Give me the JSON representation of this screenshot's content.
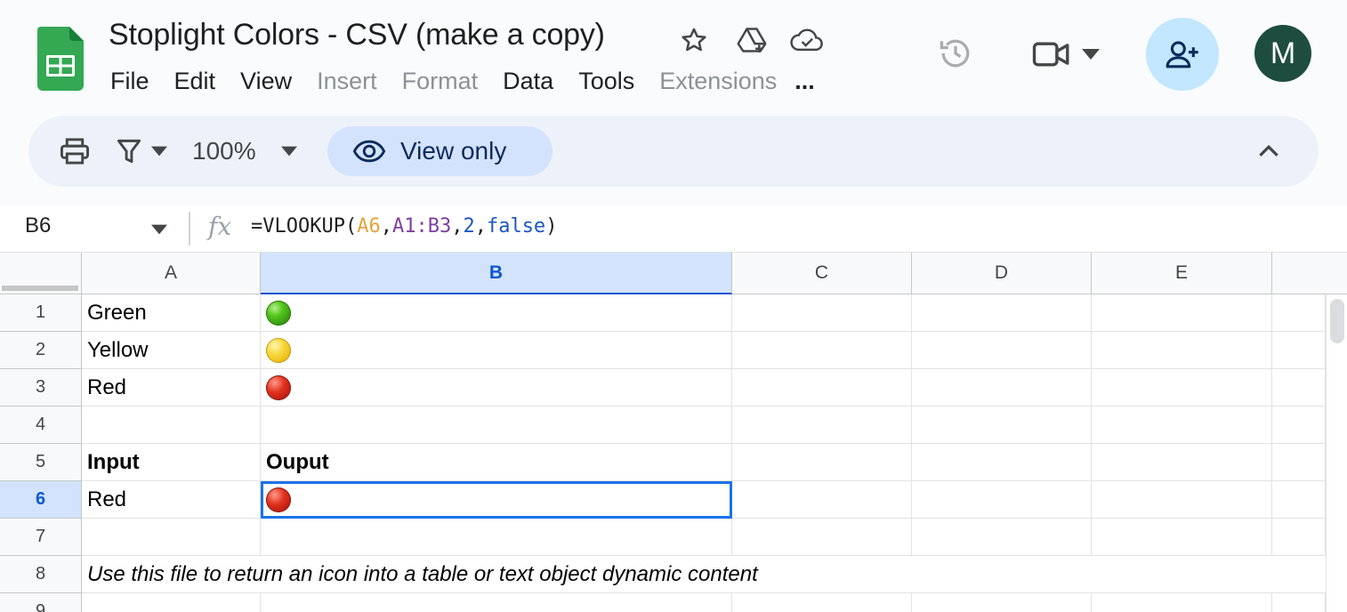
{
  "doc": {
    "title": "Stoplight Colors - CSV (make a copy)",
    "menu": [
      {
        "label": "File",
        "disabled": false
      },
      {
        "label": "Edit",
        "disabled": false
      },
      {
        "label": "View",
        "disabled": false
      },
      {
        "label": "Insert",
        "disabled": true
      },
      {
        "label": "Format",
        "disabled": true
      },
      {
        "label": "Data",
        "disabled": false
      },
      {
        "label": "Tools",
        "disabled": false
      },
      {
        "label": "Extensions",
        "disabled": true
      }
    ],
    "menu_more": "...",
    "avatar_letter": "M"
  },
  "toolbar": {
    "zoom": "100%",
    "view_only": "View only"
  },
  "formula_bar": {
    "name_box": "B6",
    "fx": "fx",
    "formula_parts": [
      {
        "text": "=VLOOKUP(",
        "color": "default"
      },
      {
        "text": "A6",
        "color": "orange"
      },
      {
        "text": ",",
        "color": "default"
      },
      {
        "text": "A1:B3",
        "color": "purple"
      },
      {
        "text": ",",
        "color": "default"
      },
      {
        "text": "2",
        "color": "blue"
      },
      {
        "text": ",",
        "color": "default"
      },
      {
        "text": "false",
        "color": "blue"
      },
      {
        "text": ")",
        "color": "default"
      }
    ]
  },
  "grid": {
    "columns": [
      "A",
      "B",
      "C",
      "D",
      "E"
    ],
    "selected_column": "B",
    "rows": [
      "1",
      "2",
      "3",
      "4",
      "5",
      "6",
      "7",
      "8",
      "9"
    ],
    "selected_row": "6",
    "selected_cell": "B6",
    "cells": {
      "A1": "Green",
      "A2": "Yellow",
      "A3": "Red",
      "A5": "Input",
      "B5": "Ouput",
      "A6": "Red",
      "A8": "Use this file to return an icon into a table or text object dynamic content"
    },
    "icons": {
      "B1": "green-circle-icon",
      "B2": "yellow-circle-icon",
      "B3": "red-circle-icon",
      "B6": "red-circle-icon"
    }
  },
  "colors": {
    "accent": "#0b57d0",
    "share_bg": "#c2e7ff",
    "view_only_bg": "#d3e3fd",
    "avatar_bg": "#1e4d3f",
    "sheets_green": "#34a853"
  }
}
